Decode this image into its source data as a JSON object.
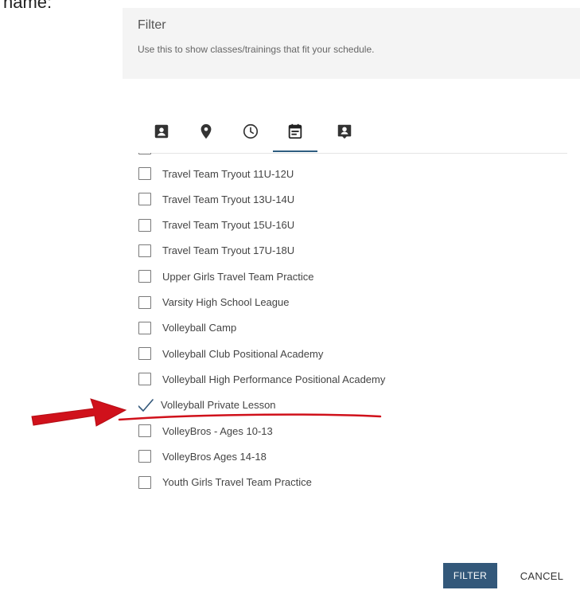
{
  "top_fragment": "name:",
  "header": {
    "title": "Filter",
    "subtitle": "Use this to show classes/trainings that fit your schedule."
  },
  "tabs": [
    {
      "icon": "contact-card-icon",
      "active": false
    },
    {
      "icon": "location-pin-icon",
      "active": false
    },
    {
      "icon": "clock-icon",
      "active": false
    },
    {
      "icon": "calendar-icon",
      "active": true
    },
    {
      "icon": "person-badge-icon",
      "active": false
    }
  ],
  "items": [
    {
      "label": "Travel Team Tryout 11U-12U",
      "checked": false
    },
    {
      "label": "Travel Team Tryout 13U-14U",
      "checked": false
    },
    {
      "label": "Travel Team Tryout 15U-16U",
      "checked": false
    },
    {
      "label": "Travel Team Tryout 17U-18U",
      "checked": false
    },
    {
      "label": "Upper Girls Travel Team Practice",
      "checked": false
    },
    {
      "label": "Varsity High School League",
      "checked": false
    },
    {
      "label": "Volleyball Camp",
      "checked": false
    },
    {
      "label": "Volleyball Club Positional Academy",
      "checked": false
    },
    {
      "label": "Volleyball High Performance Positional Academy",
      "checked": false
    },
    {
      "label": "Volleyball Private Lesson",
      "checked": true
    },
    {
      "label": "VolleyBros - Ages 10-13",
      "checked": false
    },
    {
      "label": "VolleyBros Ages 14-18",
      "checked": false
    },
    {
      "label": "Youth Girls Travel Team Practice",
      "checked": false
    }
  ],
  "buttons": {
    "filter": "FILTER",
    "cancel": "CANCEL"
  },
  "colors": {
    "accent": "#33587a",
    "annotation": "#d0111b",
    "icon": "#333333",
    "header_bg": "#f4f4f4"
  }
}
